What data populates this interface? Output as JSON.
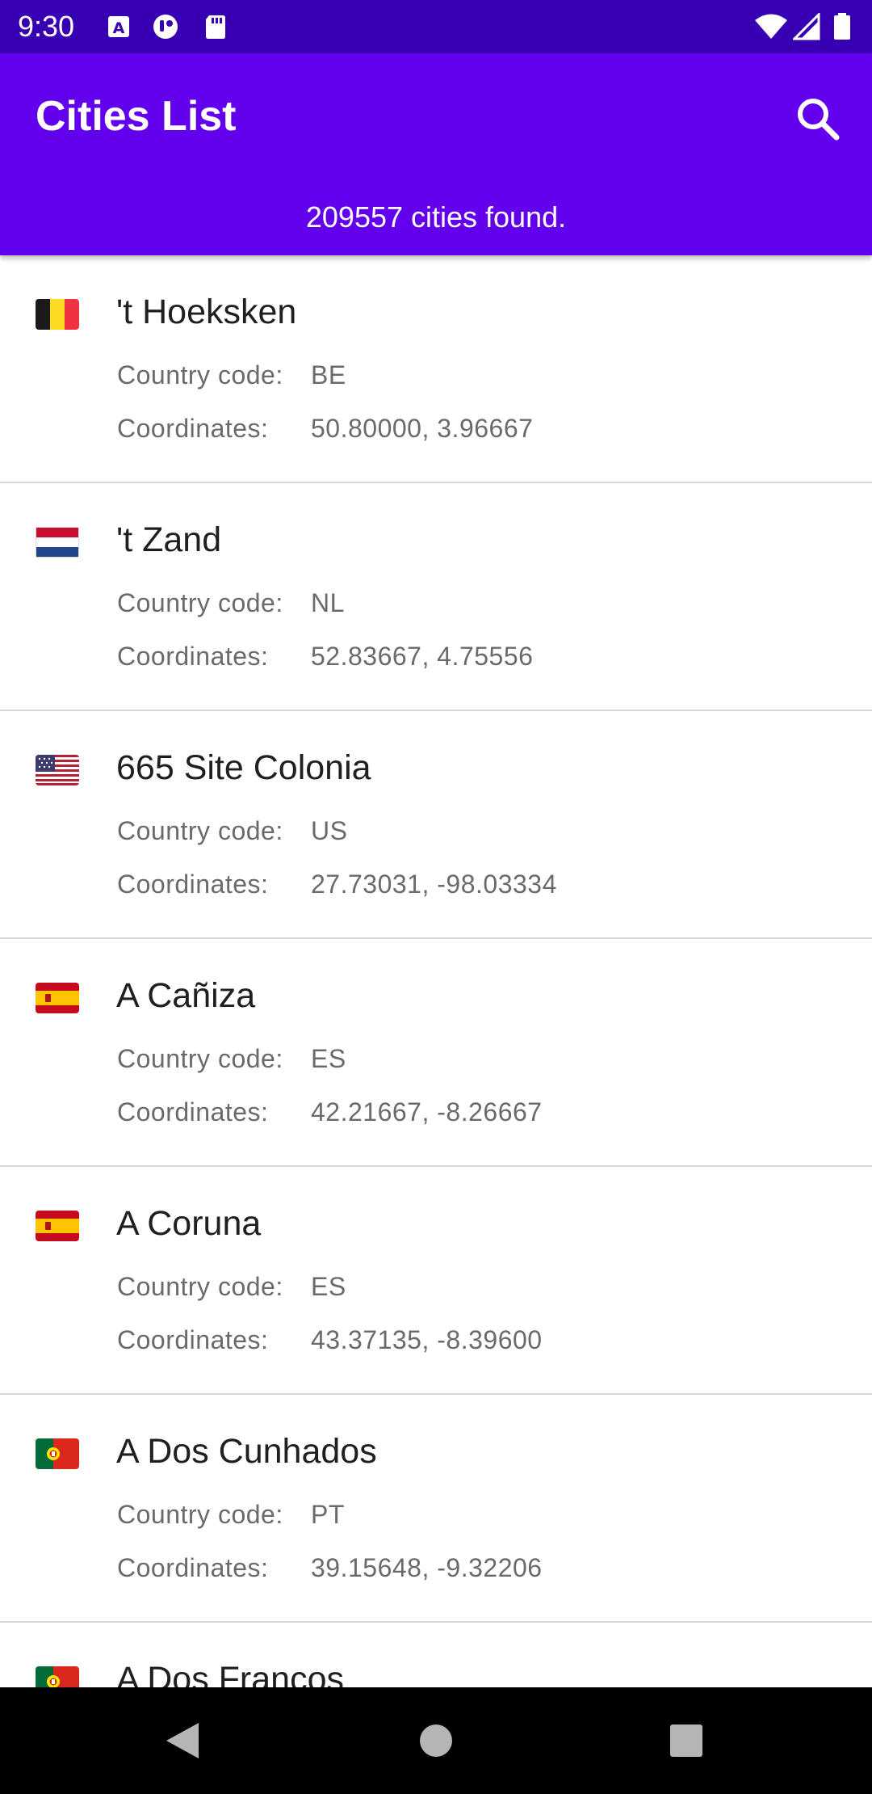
{
  "status_bar": {
    "time": "9:30",
    "left_icons": [
      "a-icon",
      "app-icon",
      "sd-card-icon"
    ],
    "right_icons": [
      "wifi-icon",
      "signal-icon",
      "battery-icon"
    ]
  },
  "app_bar": {
    "title": "Cities List",
    "search_icon": "search-icon",
    "count_text": "209557 cities found."
  },
  "labels": {
    "country_code": "Country code:",
    "coordinates": "Coordinates:"
  },
  "cities": [
    {
      "flag": "BE",
      "name": "'t Hoeksken",
      "country_code": "BE",
      "coordinates": "50.80000, 3.96667"
    },
    {
      "flag": "NL",
      "name": "'t Zand",
      "country_code": "NL",
      "coordinates": "52.83667, 4.75556"
    },
    {
      "flag": "US",
      "name": "665 Site Colonia",
      "country_code": "US",
      "coordinates": "27.73031, -98.03334"
    },
    {
      "flag": "ES",
      "name": "A Cañiza",
      "country_code": "ES",
      "coordinates": "42.21667, -8.26667"
    },
    {
      "flag": "ES",
      "name": "A Coruna",
      "country_code": "ES",
      "coordinates": "43.37135, -8.39600"
    },
    {
      "flag": "PT",
      "name": "A Dos Cunhados",
      "country_code": "PT",
      "coordinates": "39.15648, -9.32206"
    },
    {
      "flag": "PT",
      "name": "A Dos Francos",
      "country_code": "",
      "coordinates": ""
    }
  ],
  "nav_bar": {
    "icons": [
      "back-icon",
      "home-icon",
      "recents-icon"
    ]
  },
  "colors": {
    "status_bar": "#3700b3",
    "app_bar": "#6200ee",
    "divider": "#d8d8d8",
    "secondary_text": "#6a6a6a"
  }
}
